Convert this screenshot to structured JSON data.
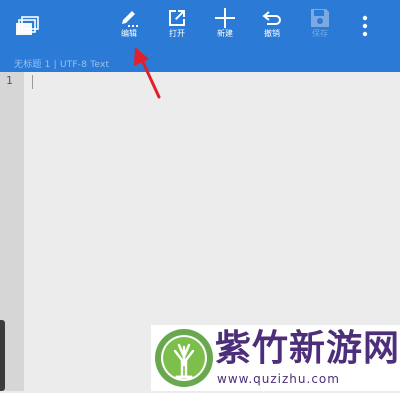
{
  "toolbar": {
    "tabs_icon": "stacked-tabs-icon",
    "items": [
      {
        "label": "编辑",
        "icon": "pencil-icon"
      },
      {
        "label": "打开",
        "icon": "open-external-icon"
      },
      {
        "label": "新建",
        "icon": "plus-icon"
      },
      {
        "label": "撤销",
        "icon": "undo-icon"
      },
      {
        "label": "保存",
        "icon": "save-icon",
        "disabled": true
      }
    ],
    "more_icon": "more-vertical-icon"
  },
  "status": {
    "text": "无标题 1  |  UTF-8  Text"
  },
  "editor": {
    "line_numbers": [
      "1"
    ]
  },
  "watermark": {
    "title": "紫竹新游网",
    "url": "www.quzizhu.com"
  },
  "colors": {
    "toolbar_bg": "#2a7ad6",
    "editor_bg": "#ececec",
    "gutter_bg": "#d6d6d6",
    "annotation_arrow": "#e0202a",
    "watermark_text": "#4d2e7a"
  }
}
